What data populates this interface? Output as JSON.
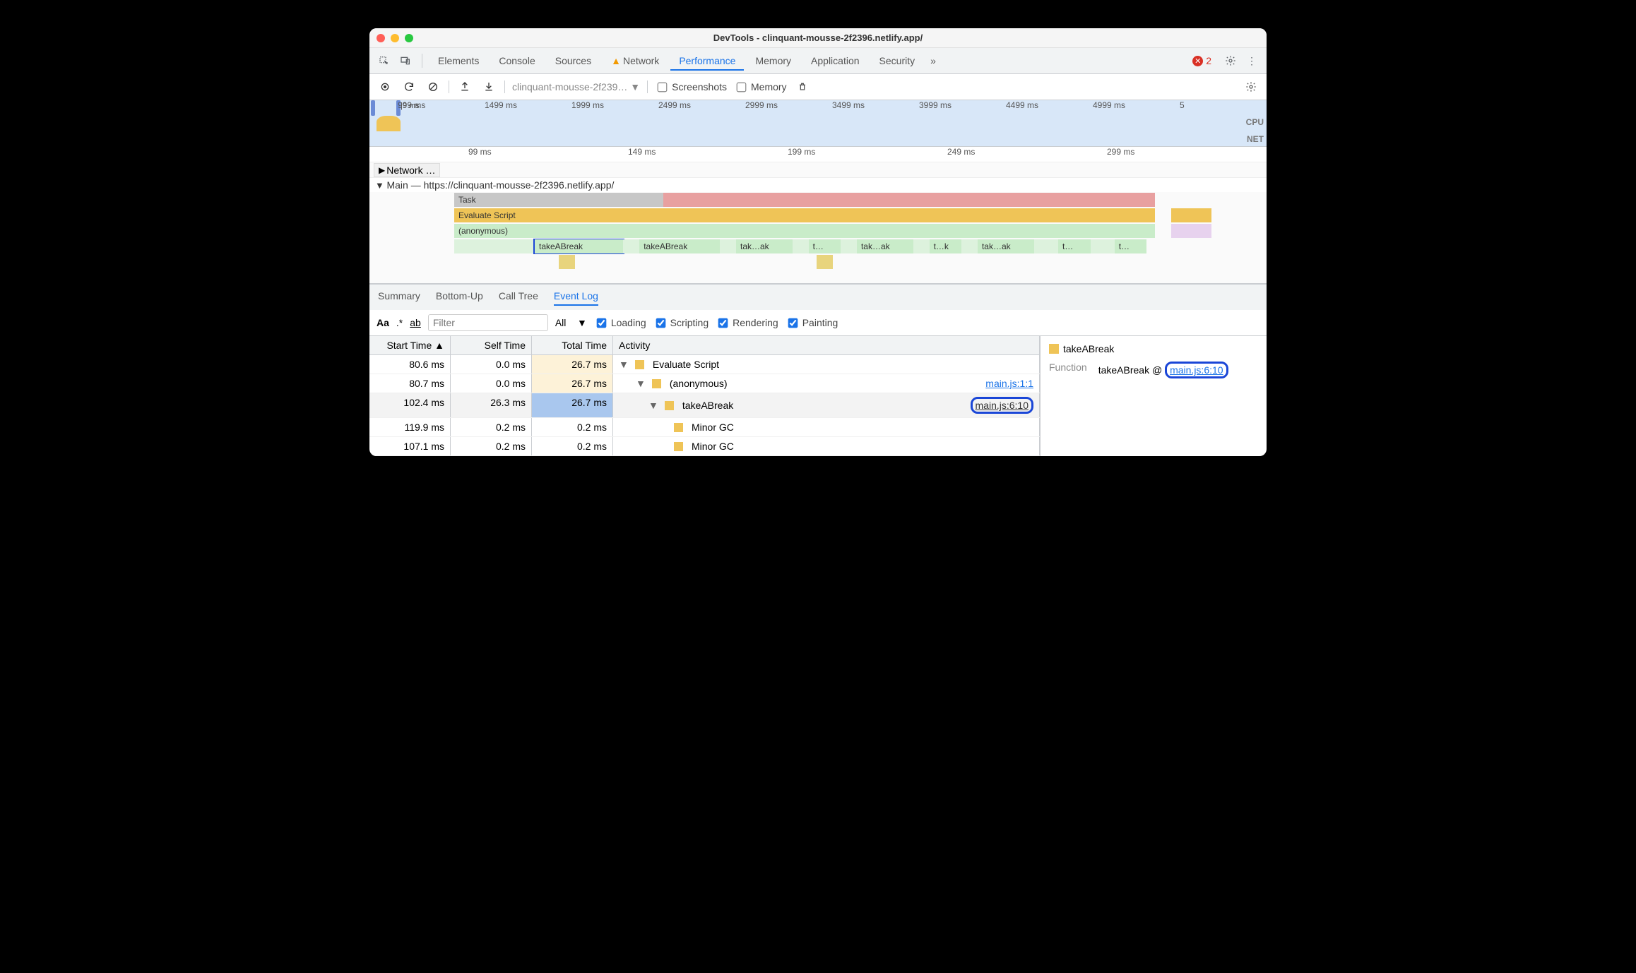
{
  "window": {
    "title": "DevTools - clinquant-mousse-2f2396.netlify.app/"
  },
  "tabs": {
    "items": [
      "Elements",
      "Console",
      "Sources",
      "Network",
      "Performance",
      "Memory",
      "Application",
      "Security"
    ],
    "active": "Performance",
    "network_warning": true,
    "more": "»",
    "errors": 2
  },
  "perf_toolbar": {
    "dropdown": "clinquant-mousse-2f239…",
    "screenshots_label": "Screenshots",
    "screenshots_checked": false,
    "memory_label": "Memory",
    "memory_checked": false
  },
  "overview": {
    "handles_ms": "|9 ms",
    "ticks": [
      "999 ms",
      "1499 ms",
      "1999 ms",
      "2499 ms",
      "2999 ms",
      "3499 ms",
      "3999 ms",
      "4499 ms",
      "4999 ms",
      "5"
    ],
    "cpu_label": "CPU",
    "net_label": "NET"
  },
  "ruler": {
    "ticks": [
      "99 ms",
      "149 ms",
      "199 ms",
      "249 ms",
      "299 ms"
    ]
  },
  "tracks": {
    "network_label": "Network …",
    "main_label": "Main — https://clinquant-mousse-2f2396.netlify.app/",
    "rows": {
      "task": "Task",
      "eval": "Evaluate Script",
      "anon": "(anonymous)",
      "calls": [
        "takeABreak",
        "takeABreak",
        "tak…ak",
        "t…",
        "tak…ak",
        "t…k",
        "tak…ak",
        "t…",
        "t…"
      ]
    }
  },
  "detail_tabs": {
    "items": [
      "Summary",
      "Bottom-Up",
      "Call Tree",
      "Event Log"
    ],
    "active": "Event Log"
  },
  "filters": {
    "aa": "Aa",
    "regex": ".*",
    "ab": "ab",
    "placeholder": "Filter",
    "all": "All",
    "loading": "Loading",
    "scripting": "Scripting",
    "rendering": "Rendering",
    "painting": "Painting"
  },
  "grid": {
    "headers": {
      "start": "Start Time",
      "self": "Self Time",
      "total": "Total Time",
      "activity": "Activity",
      "sort_asc": "▲"
    },
    "rows": [
      {
        "start": "80.6 ms",
        "self": "0.0 ms",
        "total": "26.7 ms",
        "indent": 0,
        "label": "Evaluate Script",
        "link": ""
      },
      {
        "start": "80.7 ms",
        "self": "0.0 ms",
        "total": "26.7 ms",
        "indent": 1,
        "label": "(anonymous)",
        "link": "main.js:1:1"
      },
      {
        "start": "102.4 ms",
        "self": "26.3 ms",
        "total": "26.7 ms",
        "indent": 2,
        "label": "takeABreak",
        "link": "main.js:6:10",
        "selected": true
      },
      {
        "start": "119.9 ms",
        "self": "0.2 ms",
        "total": "0.2 ms",
        "indent": 3,
        "label": "Minor GC",
        "link": ""
      },
      {
        "start": "107.1 ms",
        "self": "0.2 ms",
        "total": "0.2 ms",
        "indent": 3,
        "label": "Minor GC",
        "link": ""
      }
    ]
  },
  "sidebar": {
    "title": "takeABreak",
    "k_function": "Function",
    "v_function": "takeABreak @",
    "link": "main.js:6:10"
  }
}
